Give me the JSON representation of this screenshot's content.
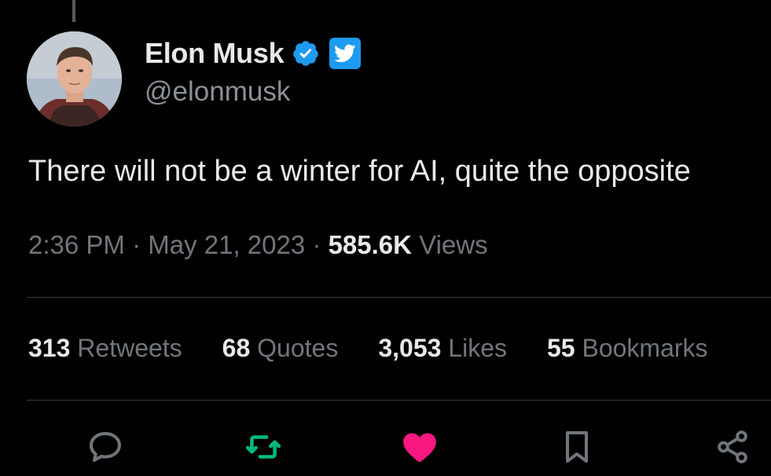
{
  "author": {
    "display_name": "Elon Musk",
    "handle": "@elonmusk",
    "verified_icon": "verified-badge-icon",
    "platform_icon": "twitter-bird-icon",
    "avatar": "avatar-photo"
  },
  "tweet": {
    "text": "There will not be a winter for AI, quite the opposite",
    "time": "2:36 PM",
    "separator": "·",
    "date": "May 21, 2023",
    "views_count": "585.6K",
    "views_label": "Views"
  },
  "stats": {
    "retweets_count": "313",
    "retweets_label": "Retweets",
    "quotes_count": "68",
    "quotes_label": "Quotes",
    "likes_count": "3,053",
    "likes_label": "Likes",
    "bookmarks_count": "55",
    "bookmarks_label": "Bookmarks"
  },
  "actions": {
    "reply_icon": "speech-bubble-icon",
    "retweet_icon": "retweet-arrows-icon",
    "like_icon": "heart-icon",
    "bookmark_icon": "bookmark-icon",
    "share_icon": "share-icon"
  },
  "colors": {
    "background": "#000000",
    "text_primary": "#e7e9ea",
    "text_secondary": "#71767b",
    "verified_blue": "#1d9bf0",
    "retweet_green": "#00ba7c",
    "like_pink": "#f91880"
  }
}
